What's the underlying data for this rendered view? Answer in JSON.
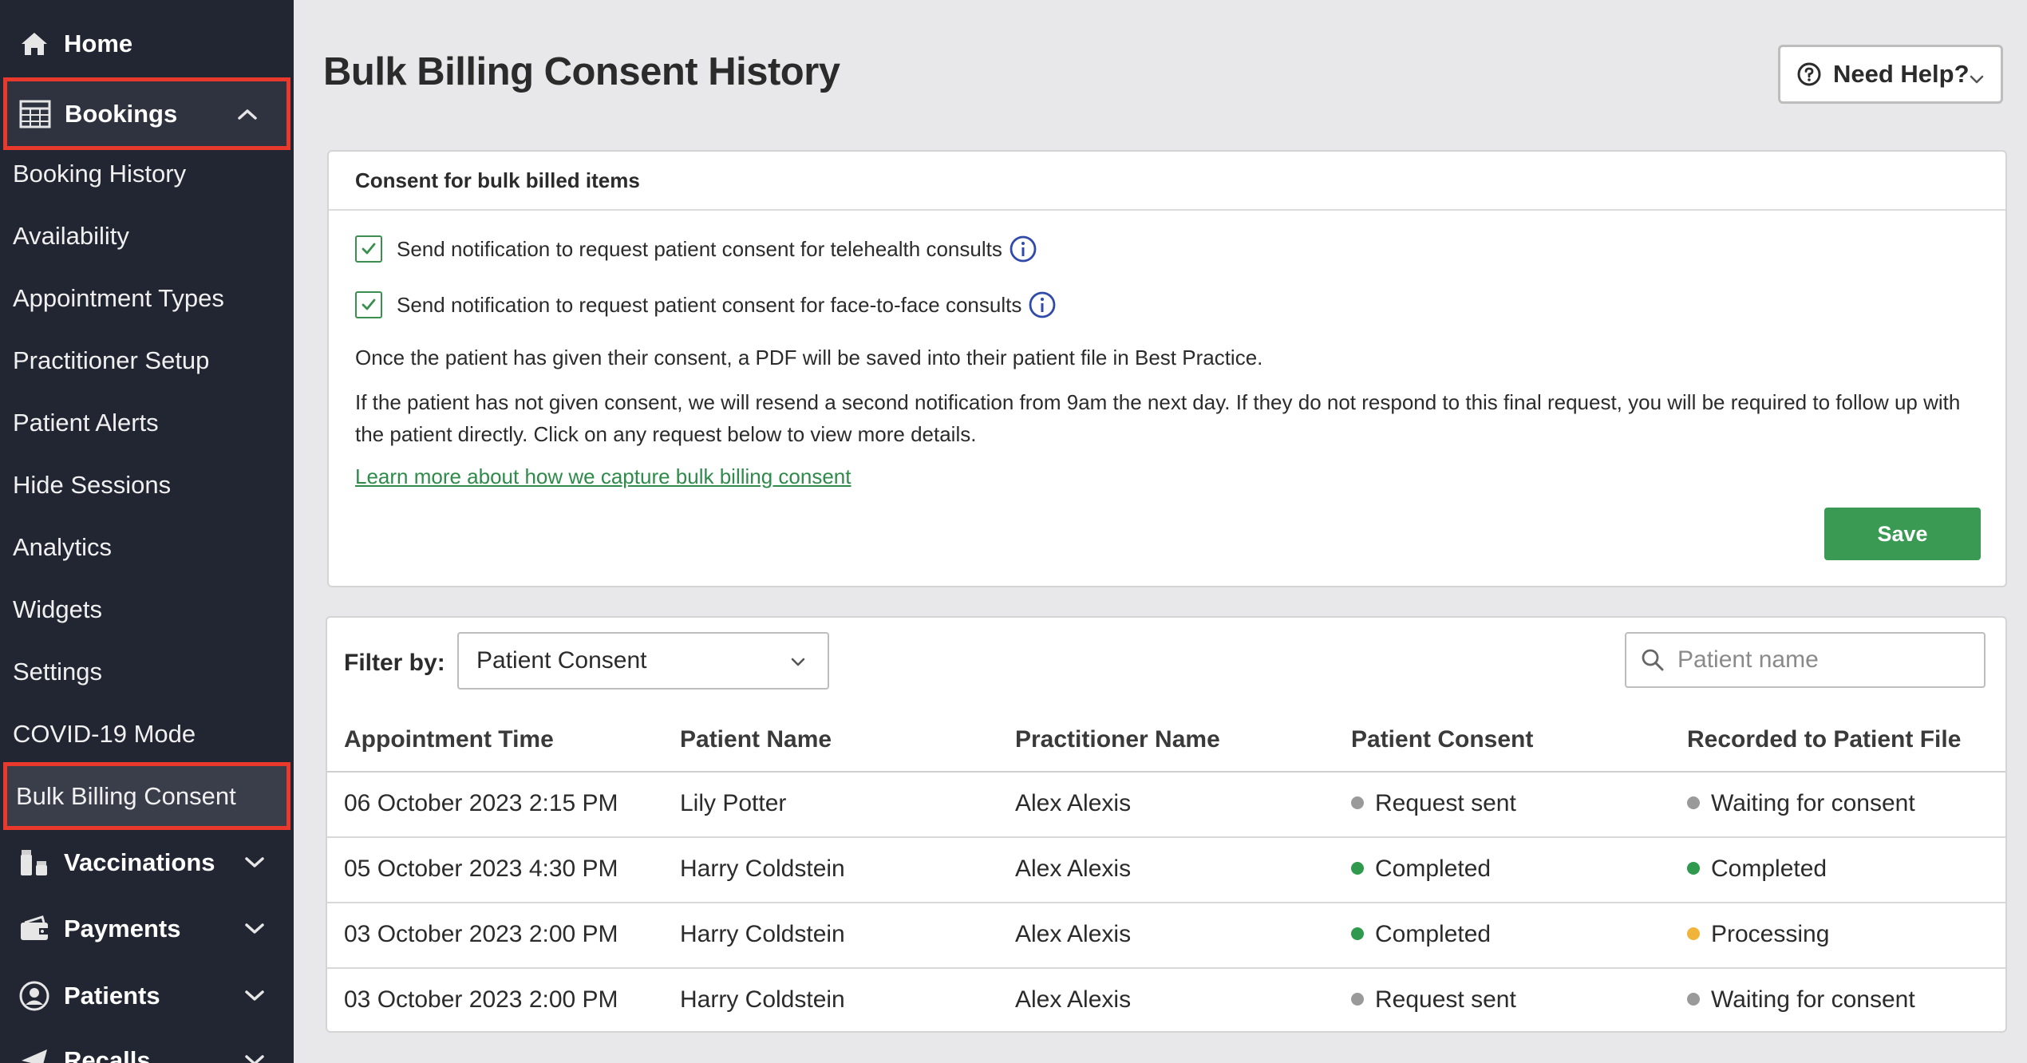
{
  "sidebar": {
    "home": "Home",
    "bookings": "Bookings",
    "sub_items": [
      "Booking History",
      "Availability",
      "Appointment Types",
      "Practitioner Setup",
      "Patient Alerts",
      "Hide Sessions",
      "Analytics",
      "Widgets",
      "Settings",
      "COVID-19 Mode",
      "Bulk Billing Consent"
    ],
    "vaccinations": "Vaccinations",
    "payments": "Payments",
    "patients": "Patients",
    "recalls": "Recalls"
  },
  "page": {
    "title": "Bulk Billing Consent History",
    "help_label": "Need Help?"
  },
  "consent": {
    "header": "Consent for bulk billed items",
    "telehealth_label": "Send notification to request patient consent for telehealth consults",
    "telehealth_checked": true,
    "f2f_label": "Send notification to request patient consent for face-to-face consults",
    "f2f_checked": true,
    "para1": "Once the patient has given their consent, a PDF will be saved into their patient file in Best Practice.",
    "para2": "If the patient has not given consent, we will resend a second notification from 9am the next day. If they do not respond to this final request, you will be required to follow up with the patient directly. Click on any request below to view more details.",
    "learn_link": "Learn more about how we capture bulk billing consent",
    "save_label": "Save"
  },
  "filter": {
    "label": "Filter by:",
    "selected": "Patient Consent",
    "search_placeholder": "Patient name"
  },
  "table": {
    "columns": [
      "Appointment Time",
      "Patient Name",
      "Practitioner Name",
      "Patient Consent",
      "Recorded to Patient File"
    ],
    "rows": [
      {
        "time": "06 October 2023 2:15 PM",
        "patient": "Lily Potter",
        "practitioner": "Alex Alexis",
        "consent": "Request sent",
        "consent_color": "#9a9a9a",
        "recorded": "Waiting for consent",
        "recorded_color": "#9a9a9a"
      },
      {
        "time": "05 October 2023 4:30 PM",
        "patient": "Harry Coldstein",
        "practitioner": "Alex Alexis",
        "consent": "Completed",
        "consent_color": "#2f9a4e",
        "recorded": "Completed",
        "recorded_color": "#2f9a4e"
      },
      {
        "time": "03 October 2023 2:00 PM",
        "patient": "Harry Coldstein",
        "practitioner": "Alex Alexis",
        "consent": "Completed",
        "consent_color": "#2f9a4e",
        "recorded": "Processing",
        "recorded_color": "#f0b43a"
      },
      {
        "time": "03 October 2023 2:00 PM",
        "patient": "Harry Coldstein",
        "practitioner": "Alex Alexis",
        "consent": "Request sent",
        "consent_color": "#9a9a9a",
        "recorded": "Waiting for consent",
        "recorded_color": "#9a9a9a"
      }
    ]
  },
  "colors": {
    "sidebar_bg": "#222632",
    "highlight": "#e8392c",
    "accent_green": "#3a9a54",
    "info_blue": "#2f4aa8"
  }
}
